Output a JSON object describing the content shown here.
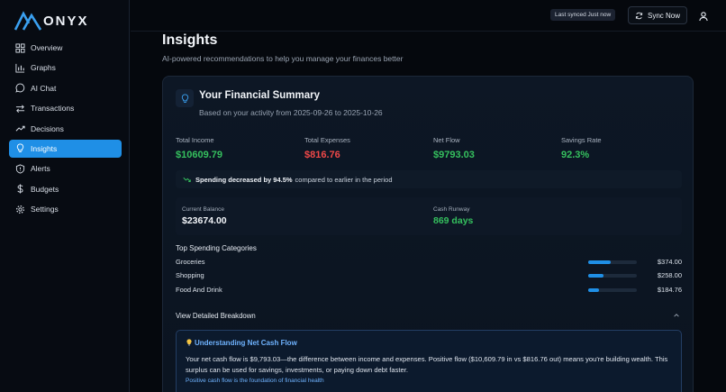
{
  "app": {
    "name": "ONYX"
  },
  "sidebar": {
    "items": [
      {
        "label": "Overview",
        "icon": "grid-icon"
      },
      {
        "label": "Graphs",
        "icon": "bar-chart-icon"
      },
      {
        "label": "AI Chat",
        "icon": "chat-bubble-icon"
      },
      {
        "label": "Transactions",
        "icon": "swap-arrows-icon"
      },
      {
        "label": "Decisions",
        "icon": "trend-up-icon"
      },
      {
        "label": "Insights",
        "icon": "lightbulb-icon",
        "active": true
      },
      {
        "label": "Alerts",
        "icon": "shield-icon"
      },
      {
        "label": "Budgets",
        "icon": "dollar-icon"
      },
      {
        "label": "Settings",
        "icon": "gear-icon"
      }
    ]
  },
  "topbar": {
    "last_synced": "Last synced Just now",
    "sync_label": "Sync Now"
  },
  "page": {
    "title": "Insights",
    "subtitle": "AI-powered recommendations to help you manage your finances better"
  },
  "summary": {
    "title": "Your Financial Summary",
    "subtitle": "Based on your activity from 2025-09-26 to 2025-10-26",
    "stats": [
      {
        "label": "Total Income",
        "value": "$10609.79",
        "color": "green"
      },
      {
        "label": "Total Expenses",
        "value": "$816.76",
        "color": "red"
      },
      {
        "label": "Net Flow",
        "value": "$9793.03",
        "color": "green"
      },
      {
        "label": "Savings Rate",
        "value": "92.3%",
        "color": "green"
      }
    ],
    "trend": {
      "bold": "Spending decreased by 94.5%",
      "rest": "compared to earlier in the period"
    },
    "balance": {
      "current_label": "Current Balance",
      "current_value": "$23674.00",
      "runway_label": "Cash Runway",
      "runway_value": "869 days"
    },
    "categories_title": "Top Spending Categories",
    "categories": [
      {
        "name": "Groceries",
        "amount": "$374.00",
        "share": 0.46
      },
      {
        "name": "Shopping",
        "amount": "$258.00",
        "share": 0.32
      },
      {
        "name": "Food And Drink",
        "amount": "$184.76",
        "share": 0.23
      }
    ],
    "breakdown_label": "View Detailed Breakdown",
    "explain": {
      "title": "Understanding Net Cash Flow",
      "body": "Your net cash flow is $9,793.03—the difference between income and expenses. Positive flow ($10,609.79 in vs $816.76 out) means you're building wealth. This surplus can be used for savings, investments, or paying down debt faster.",
      "note": "Positive cash flow is the foundation of financial health"
    }
  },
  "colors": {
    "accent": "#1f8fe6",
    "positive": "#35c05e",
    "negative": "#ef4848",
    "info": "#6fb3ff"
  }
}
